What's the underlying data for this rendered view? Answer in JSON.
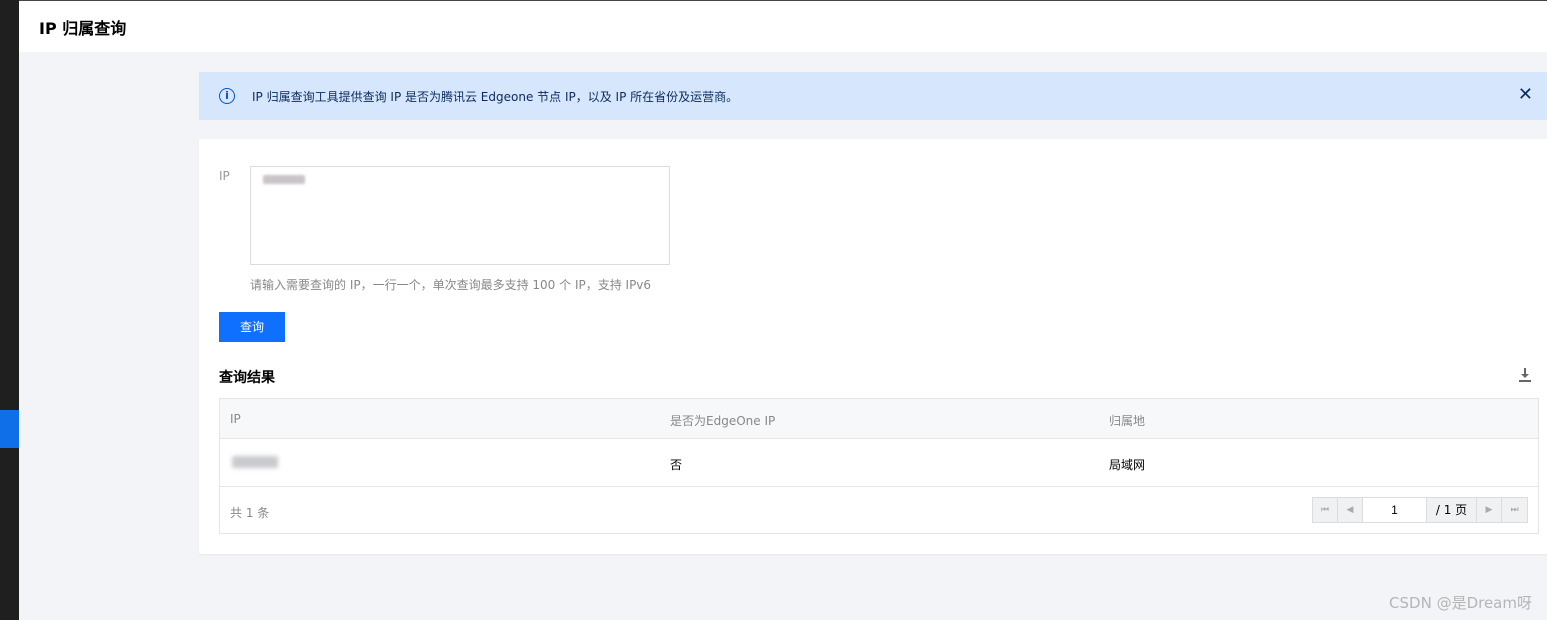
{
  "header": {
    "title": "IP 归属查询"
  },
  "notice": {
    "text": "IP 归属查询工具提供查询 IP 是否为腾讯云 Edgeone 节点 IP，以及 IP 所在省份及运营商。",
    "info_icon": "info-circle-icon",
    "close_icon": "close-icon",
    "color": "#d6e6fc"
  },
  "form": {
    "ip_label": "IP",
    "help_text": "请输入需要查询的 IP，一行一个，单次查询最多支持 100 个 IP，支持 IPv6",
    "query_button": "查询",
    "accent": "#0f6fff"
  },
  "results": {
    "title": "查询结果",
    "download_icon": "download-icon",
    "columns": [
      "IP",
      "是否为EdgeOne IP",
      "归属地"
    ],
    "rows": [
      {
        "is_edgeone": "否",
        "location": "局域网"
      }
    ],
    "total_text": "共 1 条",
    "pagination": {
      "current_page": "1",
      "total_pages_text": "/ 1 页"
    }
  },
  "watermark": "CSDN @是Dream呀"
}
